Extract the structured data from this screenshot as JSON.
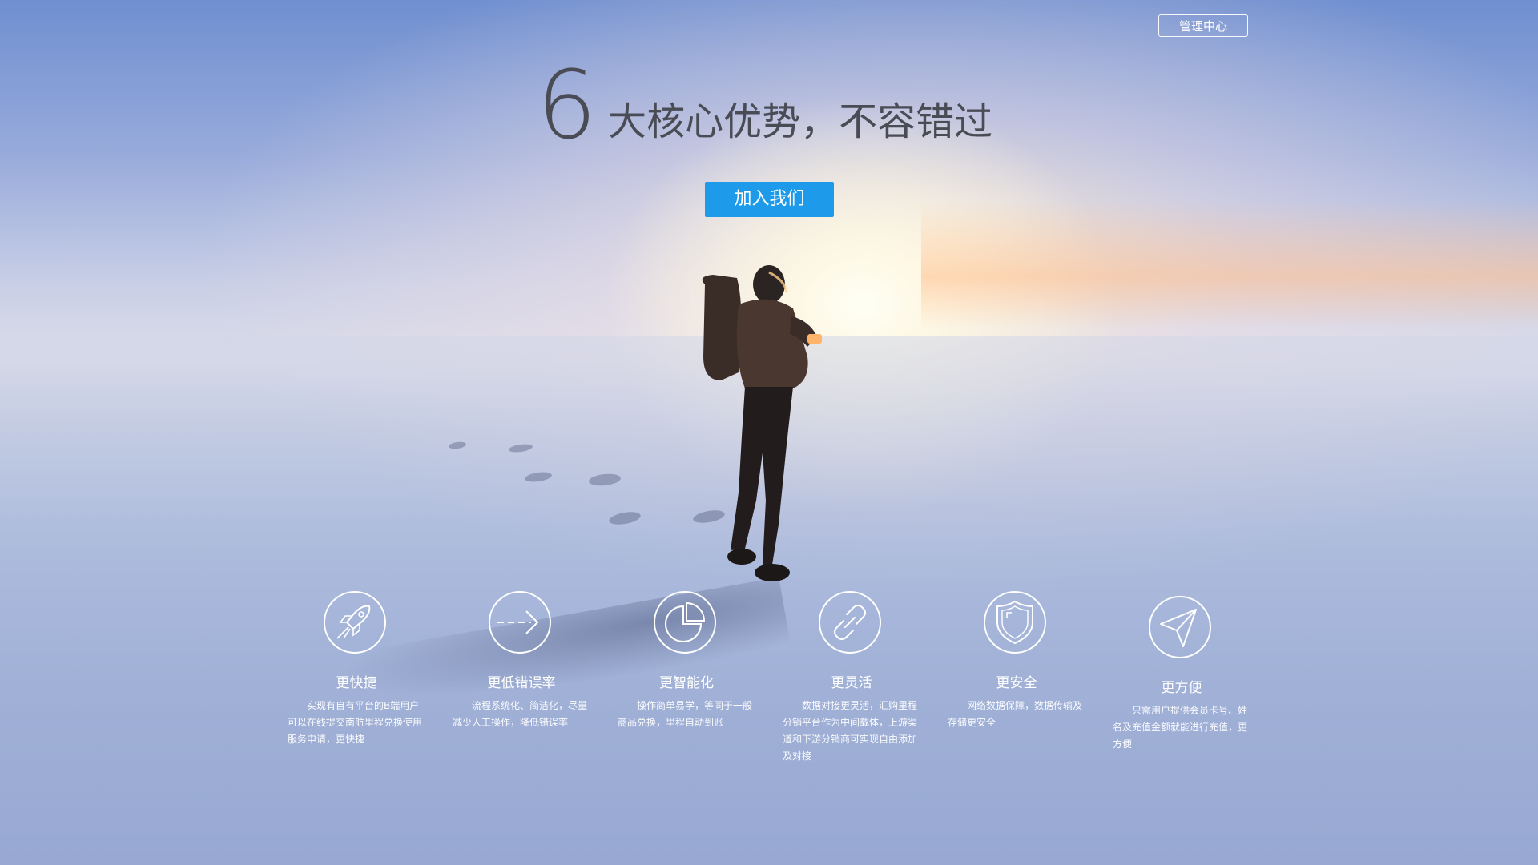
{
  "header": {
    "admin_button_label": "管理中心"
  },
  "hero": {
    "number": "6",
    "headline": "大核心优势，不容错过",
    "join_button_label": "加入我们"
  },
  "features": [
    {
      "icon": "rocket-icon",
      "title": "更快捷",
      "description": "实现有自有平台的B端用户可以在线提交南航里程兑换使用服务申请，更快捷"
    },
    {
      "icon": "dashed-arrow-icon",
      "title": "更低错误率",
      "description": "流程系统化、简洁化，尽量减少人工操作，降低错误率"
    },
    {
      "icon": "pie-chart-icon",
      "title": "更智能化",
      "description": "操作简单易学，等同于一般商品兑换，里程自动到账"
    },
    {
      "icon": "link-icon",
      "title": "更灵活",
      "description": "数据对接更灵活，汇购里程分销平台作为中间载体，上游渠道和下游分销商可实现自由添加及对接"
    },
    {
      "icon": "shield-icon",
      "title": "更安全",
      "description": "网络数据保障，数据传输及存储更安全"
    },
    {
      "icon": "paper-plane-icon",
      "title": "更方便",
      "description": "只需用户提供会员卡号、姓名及充值金额就能进行充值，更方便"
    }
  ]
}
